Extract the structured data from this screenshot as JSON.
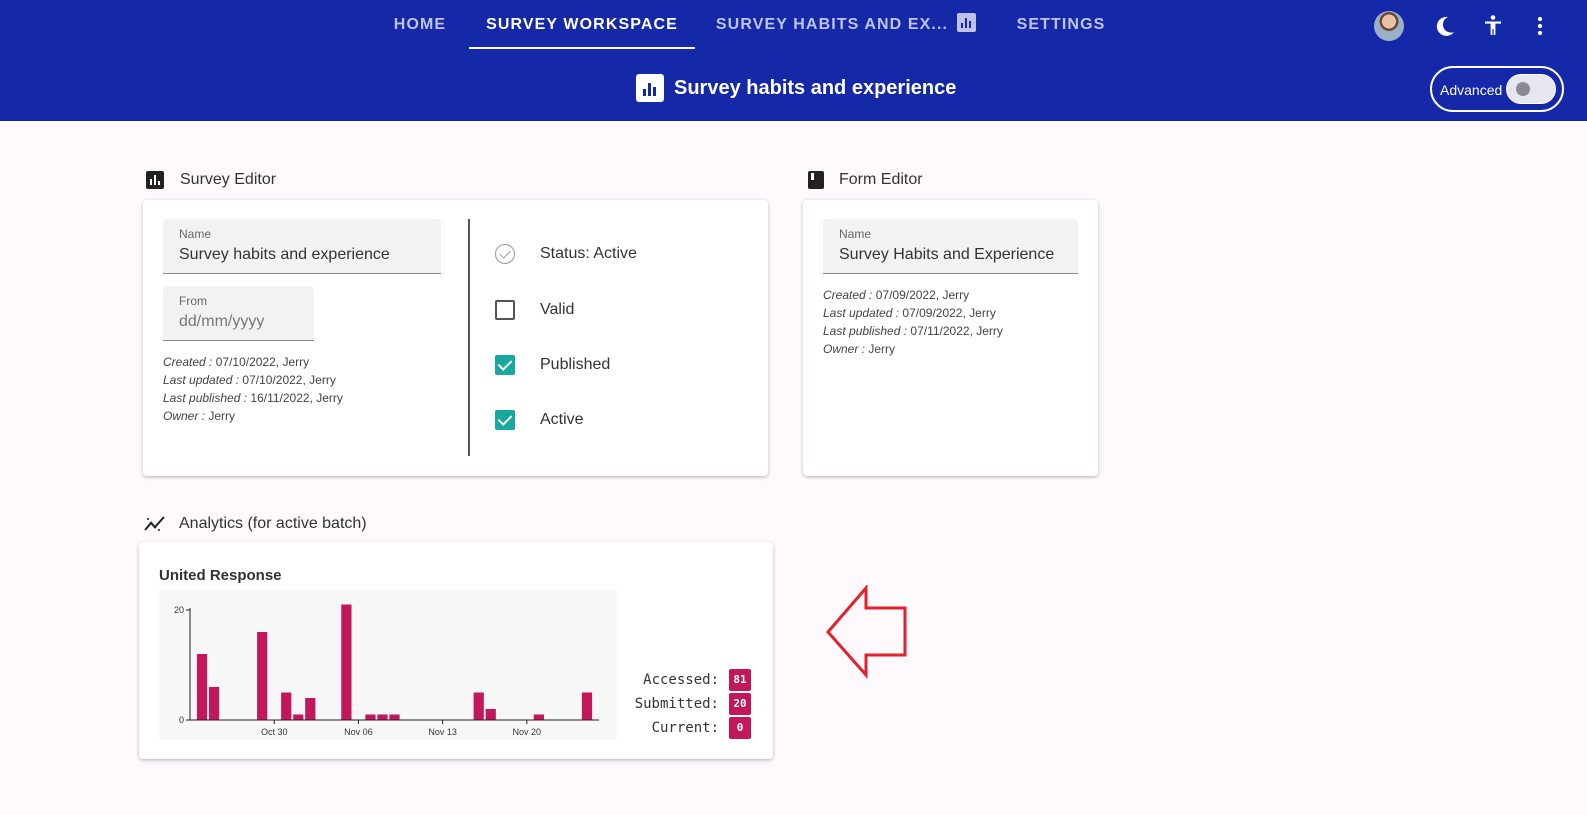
{
  "nav": {
    "tabs": [
      {
        "label": "HOME",
        "active": false
      },
      {
        "label": "SURVEY WORKSPACE",
        "active": true
      },
      {
        "label": "SURVEY HABITS AND EX...",
        "active": false,
        "icon": "bar-chart-icon"
      },
      {
        "label": "SETTINGS",
        "active": false
      }
    ],
    "right_icons": [
      "avatar",
      "dark-mode-icon",
      "accessibility-icon",
      "more-vert-icon"
    ]
  },
  "header": {
    "title": "Survey habits and experience",
    "title_icon": "bar-chart-icon",
    "advanced_label": "Advanced",
    "advanced_on": false
  },
  "survey_editor": {
    "heading": "Survey Editor",
    "name_label": "Name",
    "name_value": "Survey habits and experience",
    "from_label": "From",
    "from_placeholder": "dd/mm/yyyy",
    "meta": [
      {
        "key": "Created",
        "value": "07/10/2022, Jerry"
      },
      {
        "key": "Last updated",
        "value": "07/10/2022, Jerry"
      },
      {
        "key": "Last published",
        "value": "16/11/2022, Jerry"
      },
      {
        "key": "Owner",
        "value": "Jerry"
      }
    ],
    "status": [
      {
        "label": "Status: Active",
        "kind": "circle-check"
      },
      {
        "label": "Valid",
        "kind": "checkbox",
        "checked": false
      },
      {
        "label": "Published",
        "kind": "checkbox",
        "checked": true
      },
      {
        "label": "Active",
        "kind": "checkbox",
        "checked": true
      }
    ]
  },
  "form_editor": {
    "heading": "Form Editor",
    "name_label": "Name",
    "name_value": "Survey Habits and Experience",
    "meta": [
      {
        "key": "Created",
        "value": "07/09/2022, Jerry"
      },
      {
        "key": "Last updated",
        "value": "07/09/2022, Jerry"
      },
      {
        "key": "Last published",
        "value": "07/11/2022, Jerry"
      },
      {
        "key": "Owner",
        "value": "Jerry"
      }
    ]
  },
  "analytics": {
    "heading": "Analytics (for active batch)",
    "stats": [
      {
        "label": "Accessed:",
        "value": "81"
      },
      {
        "label": "Submitted:",
        "value": "20"
      },
      {
        "label": "Current:",
        "value": "0"
      }
    ]
  },
  "chart_data": {
    "type": "bar",
    "title": "United Response",
    "xlabel": "",
    "ylabel": "",
    "ylim": [
      0,
      20
    ],
    "yticks": [
      0,
      20
    ],
    "x_start": "2022-10-23",
    "x_end": "2022-11-26",
    "xticks": [
      {
        "label": "Oct 30",
        "date": "2022-10-30"
      },
      {
        "label": "Nov 06",
        "date": "2022-11-06"
      },
      {
        "label": "Nov 13",
        "date": "2022-11-13"
      },
      {
        "label": "Nov 20",
        "date": "2022-11-20"
      }
    ],
    "bar_color": "#c2185b",
    "grid": false,
    "points": [
      {
        "date": "2022-10-24",
        "value": 12
      },
      {
        "date": "2022-10-25",
        "value": 6
      },
      {
        "date": "2022-10-29",
        "value": 16
      },
      {
        "date": "2022-10-31",
        "value": 5
      },
      {
        "date": "2022-11-01",
        "value": 1
      },
      {
        "date": "2022-11-02",
        "value": 4
      },
      {
        "date": "2022-11-05",
        "value": 21
      },
      {
        "date": "2022-11-07",
        "value": 1
      },
      {
        "date": "2022-11-08",
        "value": 1
      },
      {
        "date": "2022-11-09",
        "value": 1
      },
      {
        "date": "2022-11-16",
        "value": 5
      },
      {
        "date": "2022-11-17",
        "value": 2
      },
      {
        "date": "2022-11-21",
        "value": 1
      },
      {
        "date": "2022-11-25",
        "value": 5
      }
    ]
  },
  "colors": {
    "appbar": "#1428a8",
    "accent_teal": "#17a99d",
    "bar": "#c2185b",
    "annotation_arrow": "#e3212b"
  }
}
